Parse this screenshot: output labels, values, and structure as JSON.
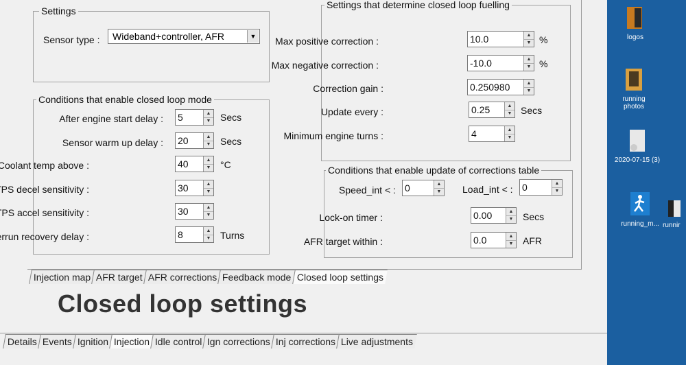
{
  "settings": {
    "title": "Settings",
    "sensor_label": "Sensor type :",
    "sensor_value": "Wideband+controller, AFR"
  },
  "enable": {
    "title": "Conditions that enable closed loop mode",
    "rows": [
      {
        "label": "After engine start delay :",
        "value": "5",
        "unit": "Secs"
      },
      {
        "label": "Sensor warm up delay :",
        "value": "20",
        "unit": "Secs"
      },
      {
        "label": "Coolant temp above :",
        "value": "40",
        "unit": "°C"
      },
      {
        "label": "TPS decel sensitivity :",
        "value": "30",
        "unit": ""
      },
      {
        "label": "TPS accel sensitivity :",
        "value": "30",
        "unit": ""
      },
      {
        "label": "Overrun recovery delay :",
        "value": "8",
        "unit": "Turns"
      }
    ]
  },
  "fuelling": {
    "title": "Settings that determine closed loop fuelling",
    "rows": [
      {
        "label": "Max positive correction :",
        "value": "10.0",
        "unit": "%"
      },
      {
        "label": "Max negative correction :",
        "value": "-10.0",
        "unit": "%"
      },
      {
        "label": "Correction gain :",
        "value": "0.250980",
        "unit": ""
      },
      {
        "label": "Update every :",
        "value": "0.25",
        "unit": "Secs"
      },
      {
        "label": "Minimum engine turns :",
        "value": "4",
        "unit": ""
      }
    ]
  },
  "update_table": {
    "title": "Conditions that enable update of corrections table",
    "speed_label": "Speed_int < :",
    "speed_value": "0",
    "load_label": "Load_int < :",
    "load_value": "0",
    "lock_label": "Lock-on timer :",
    "lock_value": "0.00",
    "lock_unit": "Secs",
    "afr_label": "AFR target within :",
    "afr_value": "0.0",
    "afr_unit": "AFR"
  },
  "inner_tabs": [
    "Injection map",
    "AFR target",
    "AFR corrections",
    "Feedback mode",
    "Closed loop settings"
  ],
  "page_title": "Closed loop settings",
  "outer_tabs": [
    "Details",
    "Events",
    "Ignition",
    "Injection",
    "Idle control",
    "Ign corrections",
    "Inj corrections",
    "Live adjustments"
  ],
  "desktop": [
    {
      "caption": "logos"
    },
    {
      "caption": "running photos"
    },
    {
      "caption": "2020-07-15 (3)"
    },
    {
      "caption": "running_m..."
    },
    {
      "caption": "runnir"
    }
  ],
  "colors": {
    "desktop_bg": "#1b5fa0",
    "window_bg": "#f0f0f0"
  }
}
